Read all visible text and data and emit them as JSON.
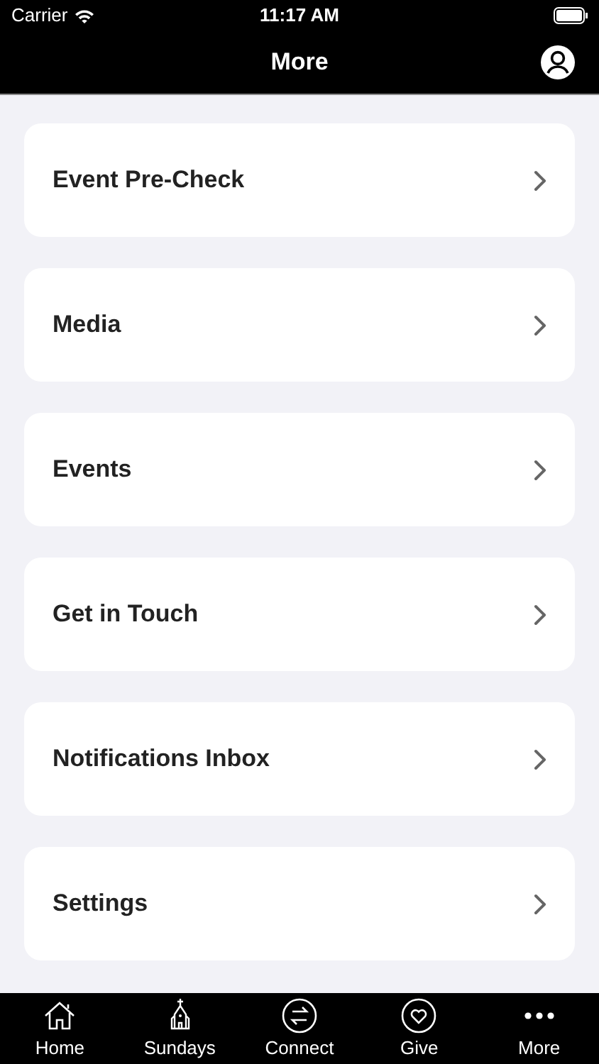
{
  "status_bar": {
    "carrier": "Carrier",
    "time": "11:17 AM"
  },
  "nav_bar": {
    "title": "More"
  },
  "menu_items": [
    {
      "label": "Event Pre-Check"
    },
    {
      "label": "Media"
    },
    {
      "label": "Events"
    },
    {
      "label": "Get in Touch"
    },
    {
      "label": "Notifications Inbox"
    },
    {
      "label": "Settings"
    }
  ],
  "tab_bar": [
    {
      "kind": "home",
      "label": "Home"
    },
    {
      "kind": "church",
      "label": "Sundays"
    },
    {
      "kind": "connect",
      "label": "Connect"
    },
    {
      "kind": "give",
      "label": "Give"
    },
    {
      "kind": "more",
      "label": "More"
    }
  ]
}
